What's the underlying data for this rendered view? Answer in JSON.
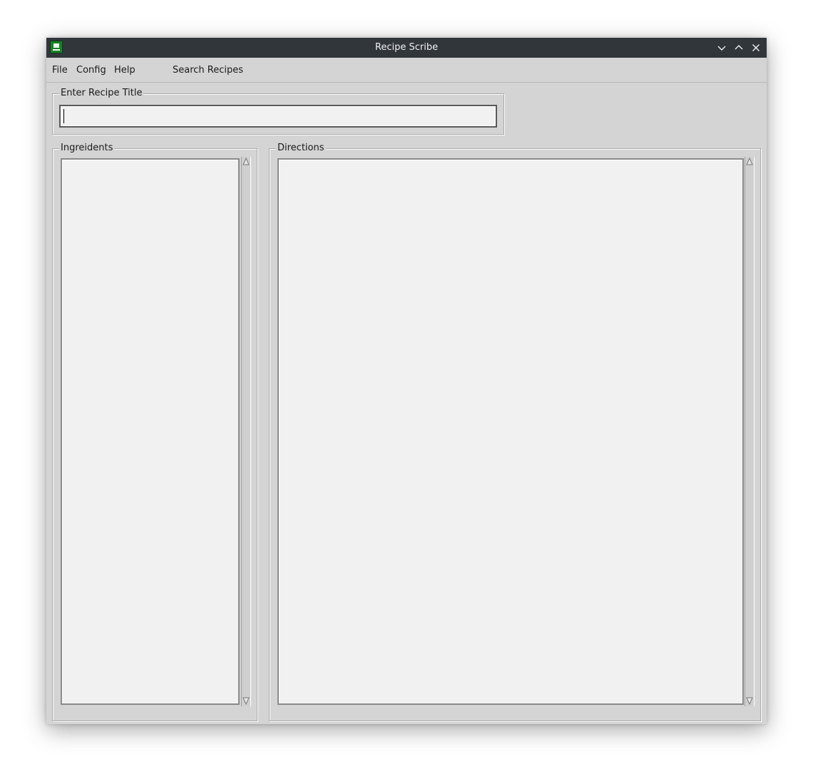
{
  "window": {
    "title": "Recipe Scribe"
  },
  "menu": {
    "file": "File",
    "config": "Config",
    "help": "Help",
    "search": "Search Recipes"
  },
  "title_group": {
    "label": "Enter Recipe Title",
    "value": ""
  },
  "ingredients": {
    "label": "Ingreidents",
    "value": ""
  },
  "directions": {
    "label": "Directions",
    "value": ""
  },
  "icons": {
    "app": "app-icon",
    "minimize": "chevron-down-icon",
    "maximize": "chevron-up-icon",
    "close": "close-icon"
  },
  "colors": {
    "titlebar": "#31363b",
    "window_bg": "#d4d4d4",
    "field_bg": "#f1f1f1"
  }
}
